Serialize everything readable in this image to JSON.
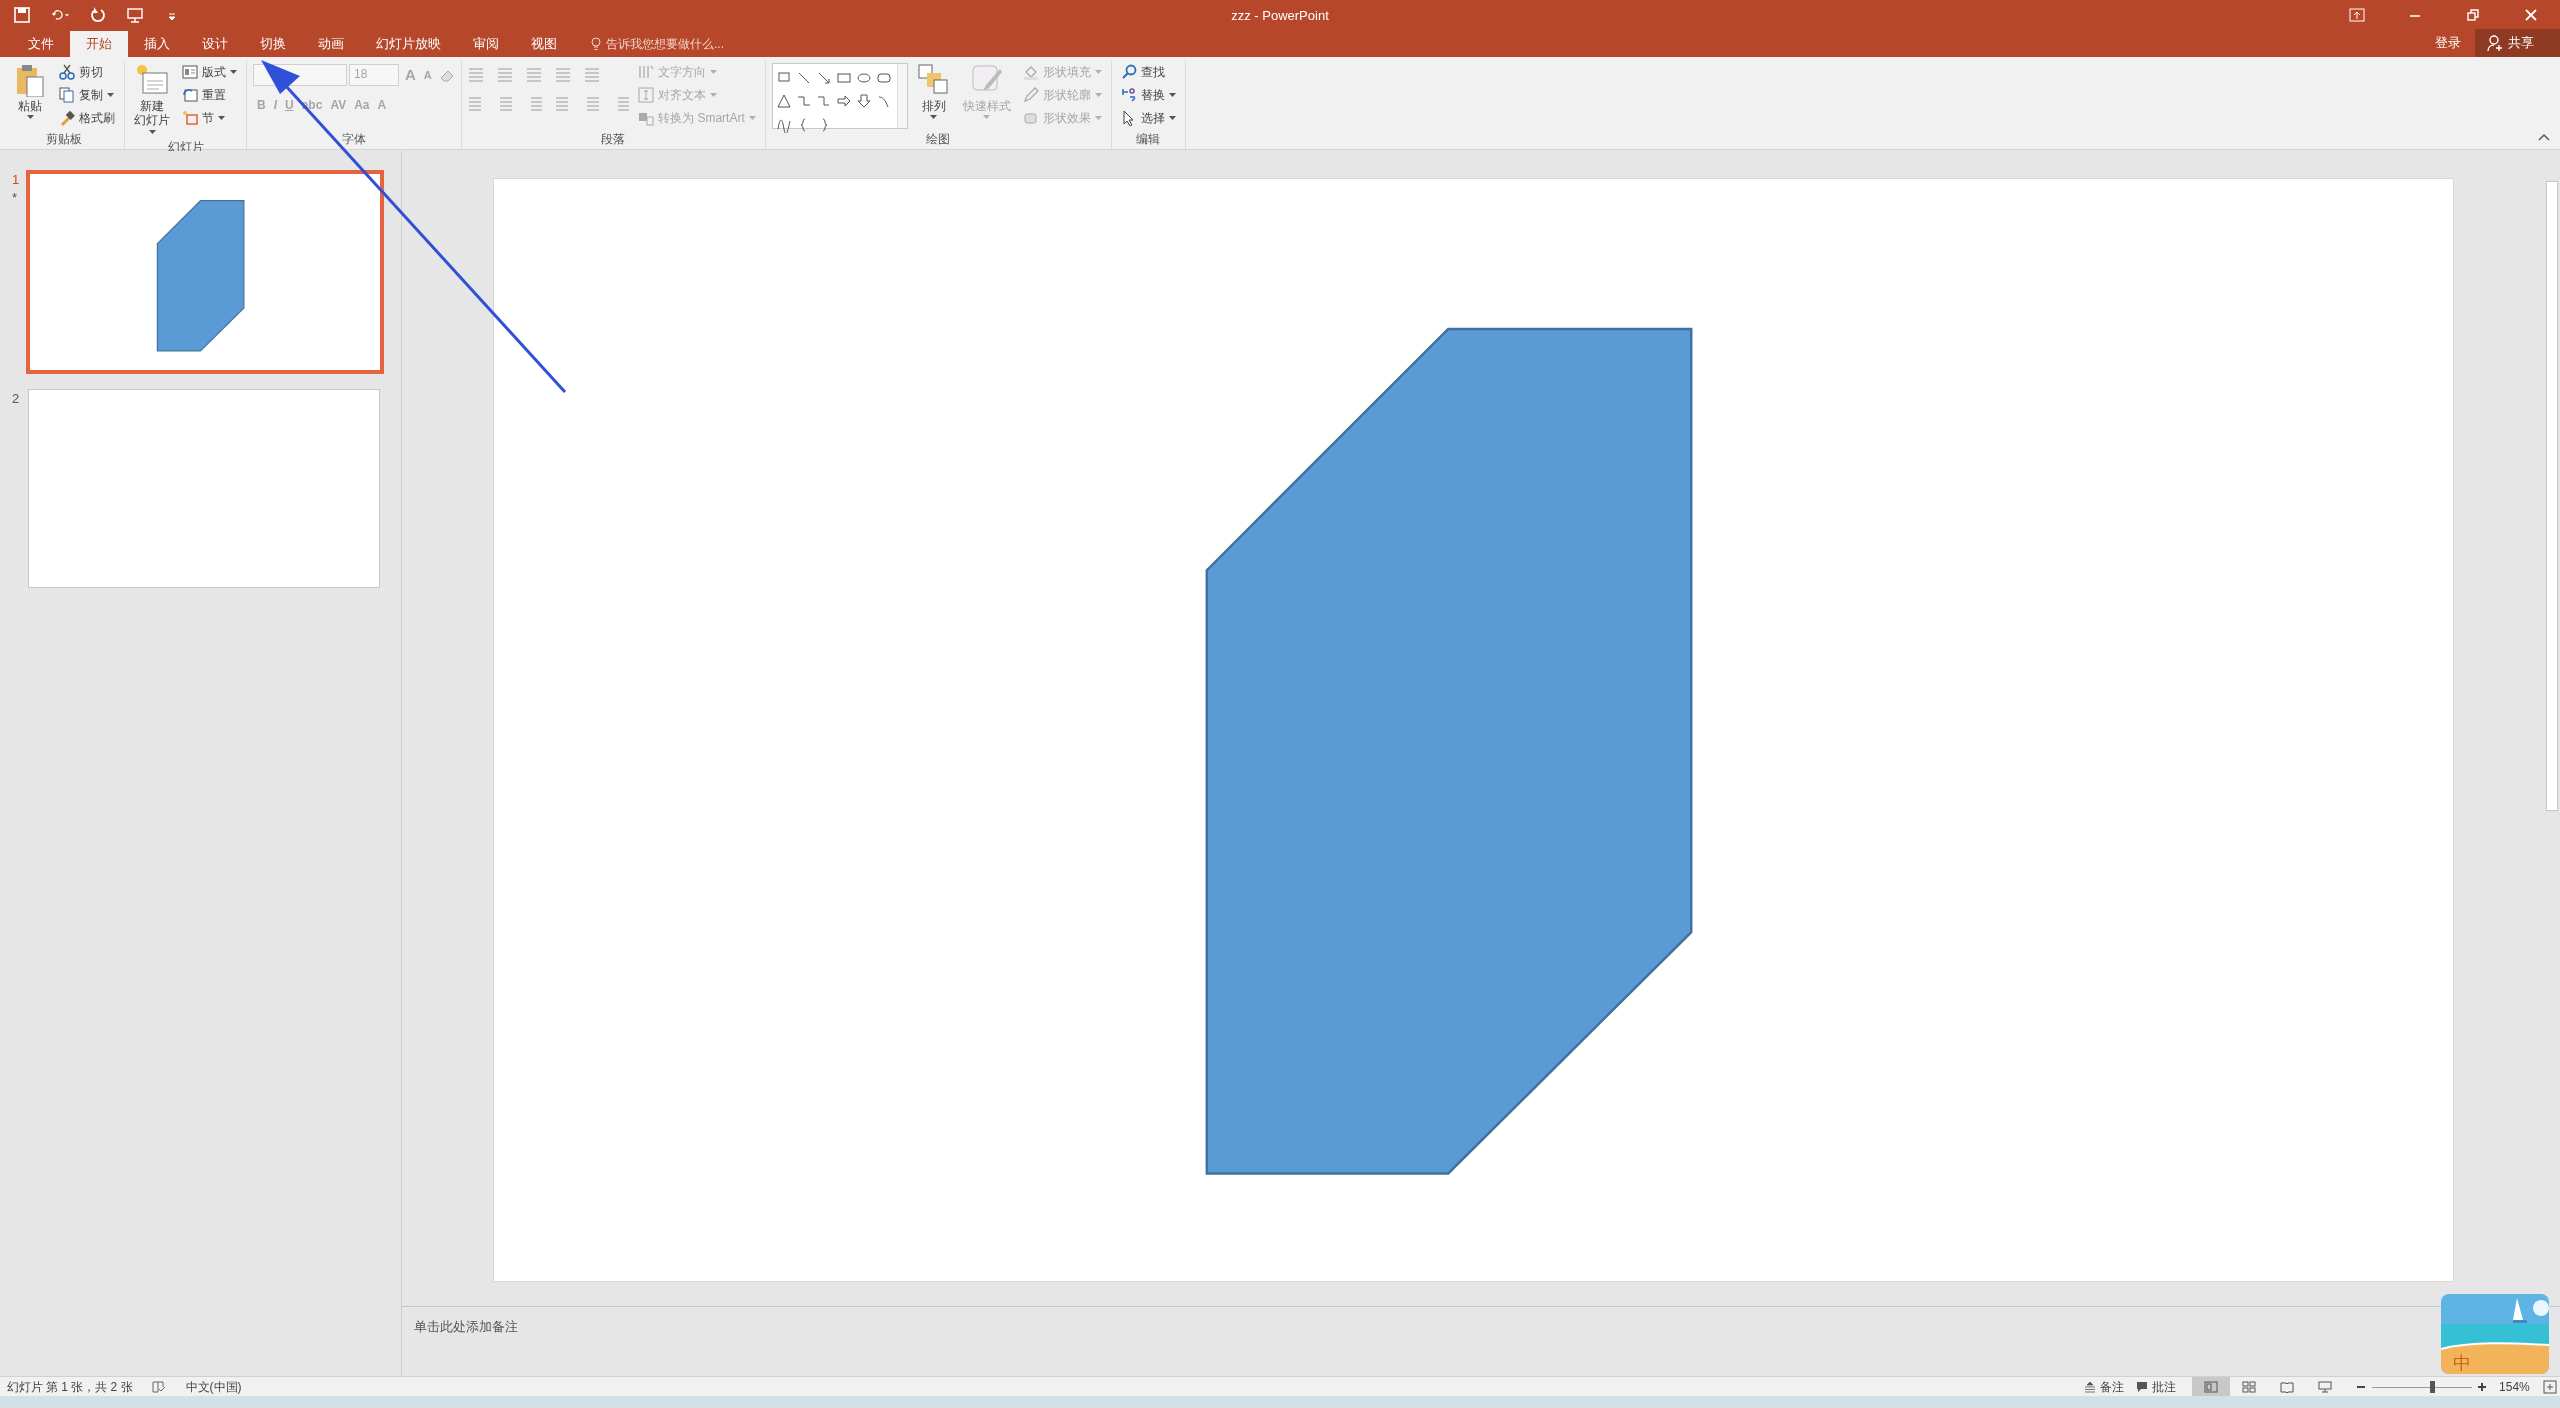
{
  "window": {
    "title": "zzz - PowerPoint"
  },
  "account": {
    "sign_in": "登录",
    "share": "共享"
  },
  "tabs": [
    {
      "label": "文件",
      "selected": false
    },
    {
      "label": "开始",
      "selected": true
    },
    {
      "label": "插入",
      "selected": false
    },
    {
      "label": "设计",
      "selected": false
    },
    {
      "label": "切换",
      "selected": false
    },
    {
      "label": "动画",
      "selected": false
    },
    {
      "label": "幻灯片放映",
      "selected": false
    },
    {
      "label": "审阅",
      "selected": false
    },
    {
      "label": "视图",
      "selected": false
    }
  ],
  "tell_me": {
    "placeholder": "告诉我您想要做什么..."
  },
  "ribbon_groups": [
    {
      "kind": "general",
      "label": "剪贴板",
      "items": [
        {
          "kind": "large",
          "label": "粘贴",
          "menu": true,
          "disabled": false
        },
        {
          "kind": "small",
          "label": "剪切",
          "menu": false,
          "disabled": false
        },
        {
          "kind": "small",
          "label": "复制",
          "menu": true,
          "disabled": false
        },
        {
          "kind": "small",
          "label": "格式刷",
          "menu": false,
          "disabled": false
        }
      ]
    },
    {
      "kind": "general",
      "label": "幻灯片",
      "items": [
        {
          "kind": "large",
          "label_lines": [
            "新建",
            "幻灯片"
          ],
          "menu": true,
          "disabled": false
        },
        {
          "kind": "small",
          "label": "版式",
          "menu": true,
          "disabled": false
        },
        {
          "kind": "small",
          "label": "重置",
          "menu": false,
          "disabled": false
        },
        {
          "kind": "small",
          "label": "节",
          "menu": true,
          "disabled": false
        }
      ]
    },
    {
      "kind": "font",
      "label": "字体",
      "top_row": [
        {
          "kind": "field",
          "disabled": true
        },
        {
          "kind": "field",
          "value": "18",
          "disabled": true
        },
        {
          "kind": "glyph",
          "label": "A",
          "disabled": true
        },
        {
          "kind": "glyph",
          "label": "A",
          "disabled": true
        }
      ],
      "bottom_row": [
        {
          "kind": "glyph",
          "label": "B",
          "disabled": true
        },
        {
          "kind": "glyph",
          "label": "I",
          "disabled": true
        },
        {
          "kind": "glyph",
          "label": "U",
          "disabled": true
        },
        {
          "kind": "glyph",
          "label": "abc",
          "disabled": true
        },
        {
          "kind": "glyph",
          "label": "AV",
          "disabled": true
        },
        {
          "kind": "glyph",
          "label": "Aa",
          "disabled": true
        },
        {
          "kind": "glyph",
          "label": "A",
          "disabled": true
        }
      ]
    },
    {
      "kind": "paragraph",
      "label": "段落",
      "items": [
        {
          "kind": "small",
          "label": "文字方向",
          "menu": true,
          "disabled": true
        },
        {
          "kind": "small",
          "label": "对齐文本",
          "menu": true,
          "disabled": true
        },
        {
          "kind": "small",
          "label": "转换为 SmartArt",
          "menu": true,
          "disabled": true
        }
      ]
    },
    {
      "kind": "drawing",
      "label": "绘图",
      "items": [
        {
          "kind": "large",
          "label": "排列",
          "menu": true,
          "disabled": false
        },
        {
          "kind": "large",
          "label": "快速样式",
          "menu": true,
          "disabled": true
        },
        {
          "kind": "small",
          "label": "形状填充",
          "menu": true,
          "disabled": true
        },
        {
          "kind": "small",
          "label": "形状轮廓",
          "menu": true,
          "disabled": true
        },
        {
          "kind": "small",
          "label": "形状效果",
          "menu": true,
          "disabled": true
        }
      ]
    },
    {
      "kind": "general",
      "label": "编辑",
      "items": [
        {
          "kind": "small",
          "label": "查找",
          "menu": false,
          "disabled": false
        },
        {
          "kind": "small",
          "label": "替换",
          "menu": true,
          "disabled": false
        },
        {
          "kind": "small",
          "label": "选择",
          "menu": true,
          "disabled": false
        }
      ]
    }
  ],
  "slides": [
    {
      "number": "1",
      "mark": "*",
      "selected": true,
      "shapes": [
        {
          "kind": "snip-rectangle"
        }
      ]
    },
    {
      "number": "2",
      "selected": false
    }
  ],
  "canvas": {
    "shapes": [
      {
        "kind": "snip-rectangle"
      }
    ]
  },
  "notes": {
    "placeholder": "单击此处添加备注"
  },
  "status_bar": {
    "slide_info": "幻灯片 第 1 张，共 2 张",
    "language": "中文(中国)",
    "notes": "备注",
    "comments": "批注",
    "views": [
      {
        "selected": true
      },
      {
        "selected": false
      },
      {
        "selected": false
      },
      {
        "selected": false
      }
    ],
    "zoom_slider": {
      "level": 0.62
    },
    "zoom": "154%"
  },
  "ime_widget": {
    "label": "中"
  }
}
